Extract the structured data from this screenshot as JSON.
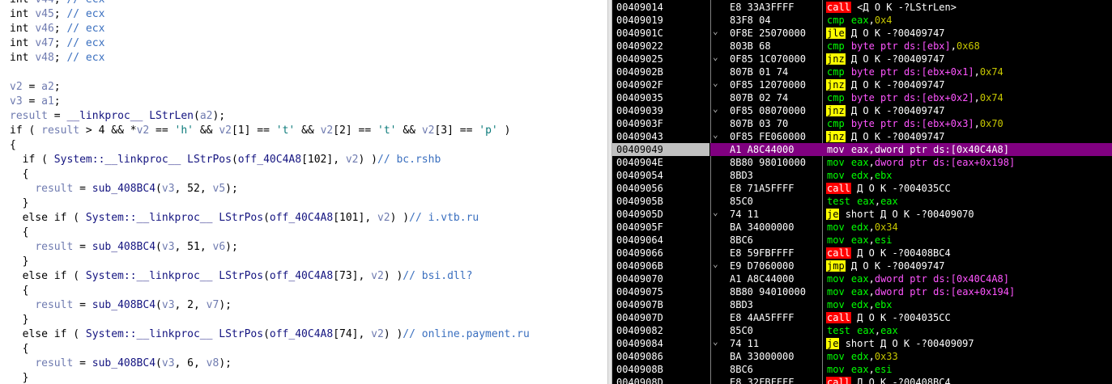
{
  "code": {
    "lines": [
      [
        [
          "kw",
          "int "
        ],
        [
          "var",
          "v44"
        ],
        [
          "kw",
          "; "
        ],
        [
          "cmt",
          "// ecx"
        ]
      ],
      [
        [
          "kw",
          "int "
        ],
        [
          "var",
          "v45"
        ],
        [
          "kw",
          "; "
        ],
        [
          "cmt",
          "// ecx"
        ]
      ],
      [
        [
          "kw",
          "int "
        ],
        [
          "var",
          "v46"
        ],
        [
          "kw",
          "; "
        ],
        [
          "cmt",
          "// ecx"
        ]
      ],
      [
        [
          "kw",
          "int "
        ],
        [
          "var",
          "v47"
        ],
        [
          "kw",
          "; "
        ],
        [
          "cmt",
          "// ecx"
        ]
      ],
      [
        [
          "kw",
          "int "
        ],
        [
          "var",
          "v48"
        ],
        [
          "kw",
          "; "
        ],
        [
          "cmt",
          "// ecx"
        ]
      ],
      [],
      [
        [
          "var",
          "v2"
        ],
        [
          "kw",
          " = "
        ],
        [
          "var",
          "a2"
        ],
        [
          "kw",
          ";"
        ]
      ],
      [
        [
          "var",
          "v3"
        ],
        [
          "kw",
          " = "
        ],
        [
          "var",
          "a1"
        ],
        [
          "kw",
          ";"
        ]
      ],
      [
        [
          "var",
          "result"
        ],
        [
          "kw",
          " = "
        ],
        [
          "fn",
          "__linkproc__ LStrLen"
        ],
        [
          "kw",
          "("
        ],
        [
          "var",
          "a2"
        ],
        [
          "kw",
          ");"
        ]
      ],
      [
        [
          "kw",
          "if ( "
        ],
        [
          "var",
          "result"
        ],
        [
          "kw",
          " > 4 && *"
        ],
        [
          "var",
          "v2"
        ],
        [
          "kw",
          " == "
        ],
        [
          "str",
          "'h'"
        ],
        [
          "kw",
          " && "
        ],
        [
          "var",
          "v2"
        ],
        [
          "kw",
          "[1] == "
        ],
        [
          "str",
          "'t'"
        ],
        [
          "kw",
          " && "
        ],
        [
          "var",
          "v2"
        ],
        [
          "kw",
          "[2] == "
        ],
        [
          "str",
          "'t'"
        ],
        [
          "kw",
          " && "
        ],
        [
          "var",
          "v2"
        ],
        [
          "kw",
          "[3] == "
        ],
        [
          "str",
          "'p'"
        ],
        [
          "kw",
          " )"
        ]
      ],
      [
        [
          "kw",
          "{"
        ]
      ],
      [
        [
          "kw",
          "  if ( "
        ],
        [
          "fn",
          "System::__linkproc__ LStrPos"
        ],
        [
          "kw",
          "("
        ],
        [
          "fn",
          "off_40C4A8"
        ],
        [
          "kw",
          "[102], "
        ],
        [
          "var",
          "v2"
        ],
        [
          "kw",
          ") )"
        ],
        [
          "cmt",
          "// bc.rshb"
        ]
      ],
      [
        [
          "kw",
          "  {"
        ]
      ],
      [
        [
          "kw",
          "    "
        ],
        [
          "var",
          "result"
        ],
        [
          "kw",
          " = "
        ],
        [
          "fn",
          "sub_408BC4"
        ],
        [
          "kw",
          "("
        ],
        [
          "var",
          "v3"
        ],
        [
          "kw",
          ", 52, "
        ],
        [
          "var",
          "v5"
        ],
        [
          "kw",
          ");"
        ]
      ],
      [
        [
          "kw",
          "  }"
        ]
      ],
      [
        [
          "kw",
          "  else if ( "
        ],
        [
          "fn",
          "System::__linkproc__ LStrPos"
        ],
        [
          "kw",
          "("
        ],
        [
          "fn",
          "off_40C4A8"
        ],
        [
          "kw",
          "[101], "
        ],
        [
          "var",
          "v2"
        ],
        [
          "kw",
          ") )"
        ],
        [
          "cmt",
          "// i.vtb.ru"
        ]
      ],
      [
        [
          "kw",
          "  {"
        ]
      ],
      [
        [
          "kw",
          "    "
        ],
        [
          "var",
          "result"
        ],
        [
          "kw",
          " = "
        ],
        [
          "fn",
          "sub_408BC4"
        ],
        [
          "kw",
          "("
        ],
        [
          "var",
          "v3"
        ],
        [
          "kw",
          ", 51, "
        ],
        [
          "var",
          "v6"
        ],
        [
          "kw",
          ");"
        ]
      ],
      [
        [
          "kw",
          "  }"
        ]
      ],
      [
        [
          "kw",
          "  else if ( "
        ],
        [
          "fn",
          "System::__linkproc__ LStrPos"
        ],
        [
          "kw",
          "("
        ],
        [
          "fn",
          "off_40C4A8"
        ],
        [
          "kw",
          "[73], "
        ],
        [
          "var",
          "v2"
        ],
        [
          "kw",
          ") )"
        ],
        [
          "cmt",
          "// bsi.dll?"
        ]
      ],
      [
        [
          "kw",
          "  {"
        ]
      ],
      [
        [
          "kw",
          "    "
        ],
        [
          "var",
          "result"
        ],
        [
          "kw",
          " = "
        ],
        [
          "fn",
          "sub_408BC4"
        ],
        [
          "kw",
          "("
        ],
        [
          "var",
          "v3"
        ],
        [
          "kw",
          ", 2, "
        ],
        [
          "var",
          "v7"
        ],
        [
          "kw",
          ");"
        ]
      ],
      [
        [
          "kw",
          "  }"
        ]
      ],
      [
        [
          "kw",
          "  else if ( "
        ],
        [
          "fn",
          "System::__linkproc__ LStrPos"
        ],
        [
          "kw",
          "("
        ],
        [
          "fn",
          "off_40C4A8"
        ],
        [
          "kw",
          "[74], "
        ],
        [
          "var",
          "v2"
        ],
        [
          "kw",
          ") )"
        ],
        [
          "cmt",
          "// online.payment.ru"
        ]
      ],
      [
        [
          "kw",
          "  {"
        ]
      ],
      [
        [
          "kw",
          "    "
        ],
        [
          "var",
          "result"
        ],
        [
          "kw",
          " = "
        ],
        [
          "fn",
          "sub_408BC4"
        ],
        [
          "kw",
          "("
        ],
        [
          "var",
          "v3"
        ],
        [
          "kw",
          ", 6, "
        ],
        [
          "var",
          "v8"
        ],
        [
          "kw",
          ");"
        ]
      ],
      [
        [
          "kw",
          "  }"
        ]
      ]
    ]
  },
  "disasm": {
    "selected_index": 11,
    "rows": [
      {
        "addr": "00409014",
        "arrow": "",
        "bytes": "E8 33A3FFFF",
        "mn": "call",
        "cls": "call",
        "ops": [
          [
            "lbl",
            "<Д О К -?LStrLen>"
          ]
        ]
      },
      {
        "addr": "00409019",
        "arrow": "",
        "bytes": "83F8 04",
        "mn": "cmp",
        "cls": "cmp",
        "ops": [
          [
            "reg",
            "eax"
          ],
          [
            "comma",
            ","
          ],
          [
            "imm",
            "0x4"
          ]
        ]
      },
      {
        "addr": "0040901C",
        "arrow": "⌄",
        "bytes": "0F8E 25070000",
        "mn": "jle",
        "cls": "jcc",
        "ops": [
          [
            "lbl",
            "Д О К -?00409747"
          ]
        ]
      },
      {
        "addr": "00409022",
        "arrow": "",
        "bytes": "803B 68",
        "mn": "cmp",
        "cls": "cmp",
        "ops": [
          [
            "mem",
            "byte ptr ds:[ebx]"
          ],
          [
            "comma",
            ","
          ],
          [
            "imm",
            "0x68"
          ]
        ]
      },
      {
        "addr": "00409025",
        "arrow": "⌄",
        "bytes": "0F85 1C070000",
        "mn": "jnz",
        "cls": "jcc",
        "ops": [
          [
            "lbl",
            "Д О К -?00409747"
          ]
        ]
      },
      {
        "addr": "0040902B",
        "arrow": "",
        "bytes": "807B 01 74",
        "mn": "cmp",
        "cls": "cmp",
        "ops": [
          [
            "mem",
            "byte ptr ds:[ebx+0x1]"
          ],
          [
            "comma",
            ","
          ],
          [
            "imm",
            "0x74"
          ]
        ]
      },
      {
        "addr": "0040902F",
        "arrow": "⌄",
        "bytes": "0F85 12070000",
        "mn": "jnz",
        "cls": "jcc",
        "ops": [
          [
            "lbl",
            "Д О К -?00409747"
          ]
        ]
      },
      {
        "addr": "00409035",
        "arrow": "",
        "bytes": "807B 02 74",
        "mn": "cmp",
        "cls": "cmp",
        "ops": [
          [
            "mem",
            "byte ptr ds:[ebx+0x2]"
          ],
          [
            "comma",
            ","
          ],
          [
            "imm",
            "0x74"
          ]
        ]
      },
      {
        "addr": "00409039",
        "arrow": "⌄",
        "bytes": "0F85 08070000",
        "mn": "jnz",
        "cls": "jcc",
        "ops": [
          [
            "lbl",
            "Д О К -?00409747"
          ]
        ]
      },
      {
        "addr": "0040903F",
        "arrow": "",
        "bytes": "807B 03 70",
        "mn": "cmp",
        "cls": "cmp",
        "ops": [
          [
            "mem",
            "byte ptr ds:[ebx+0x3]"
          ],
          [
            "comma",
            ","
          ],
          [
            "imm",
            "0x70"
          ]
        ]
      },
      {
        "addr": "00409043",
        "arrow": "⌄",
        "bytes": "0F85 FE060000",
        "mn": "jnz",
        "cls": "jcc",
        "ops": [
          [
            "lbl",
            "Д О К -?00409747"
          ]
        ]
      },
      {
        "addr": "00409049",
        "arrow": "",
        "bytes": "A1 A8C44000",
        "mn": "mov",
        "cls": "mov",
        "ops": [
          [
            "reg",
            "eax"
          ],
          [
            "comma",
            ","
          ],
          [
            "mem",
            "dword ptr ds:[0x40C4A8]"
          ]
        ]
      },
      {
        "addr": "0040904E",
        "arrow": "",
        "bytes": "8B80 98010000",
        "mn": "mov",
        "cls": "mov",
        "ops": [
          [
            "reg",
            "eax"
          ],
          [
            "comma",
            ","
          ],
          [
            "mem",
            "dword ptr ds:[eax+0x198]"
          ]
        ]
      },
      {
        "addr": "00409054",
        "arrow": "",
        "bytes": "8BD3",
        "mn": "mov",
        "cls": "mov",
        "ops": [
          [
            "reg",
            "edx"
          ],
          [
            "comma",
            ","
          ],
          [
            "reg",
            "ebx"
          ]
        ]
      },
      {
        "addr": "00409056",
        "arrow": "",
        "bytes": "E8 71A5FFFF",
        "mn": "call",
        "cls": "call",
        "ops": [
          [
            "lbl",
            "Д О К -?004035CC"
          ]
        ]
      },
      {
        "addr": "0040905B",
        "arrow": "",
        "bytes": "85C0",
        "mn": "test",
        "cls": "test",
        "ops": [
          [
            "reg",
            "eax"
          ],
          [
            "comma",
            ","
          ],
          [
            "reg",
            "eax"
          ]
        ]
      },
      {
        "addr": "0040905D",
        "arrow": "⌄",
        "bytes": "74 11",
        "mn": "je",
        "cls": "jcc",
        "ops": [
          [
            "lbl",
            "short Д О К -?00409070"
          ]
        ]
      },
      {
        "addr": "0040905F",
        "arrow": "",
        "bytes": "BA 34000000",
        "mn": "mov",
        "cls": "mov",
        "ops": [
          [
            "reg",
            "edx"
          ],
          [
            "comma",
            ","
          ],
          [
            "imm",
            "0x34"
          ]
        ]
      },
      {
        "addr": "00409064",
        "arrow": "",
        "bytes": "8BC6",
        "mn": "mov",
        "cls": "mov",
        "ops": [
          [
            "reg",
            "eax"
          ],
          [
            "comma",
            ","
          ],
          [
            "reg",
            "esi"
          ]
        ]
      },
      {
        "addr": "00409066",
        "arrow": "",
        "bytes": "E8 59FBFFFF",
        "mn": "call",
        "cls": "call",
        "ops": [
          [
            "lbl",
            "Д О К -?00408BC4"
          ]
        ]
      },
      {
        "addr": "0040906B",
        "arrow": "⌄",
        "bytes": "E9 D7060000",
        "mn": "jmp",
        "cls": "jcc",
        "ops": [
          [
            "lbl",
            "Д О К -?00409747"
          ]
        ]
      },
      {
        "addr": "00409070",
        "arrow": "",
        "bytes": "A1 A8C44000",
        "mn": "mov",
        "cls": "mov",
        "ops": [
          [
            "reg",
            "eax"
          ],
          [
            "comma",
            ","
          ],
          [
            "mem",
            "dword ptr ds:[0x40C4A8]"
          ]
        ]
      },
      {
        "addr": "00409075",
        "arrow": "",
        "bytes": "8B80 94010000",
        "mn": "mov",
        "cls": "mov",
        "ops": [
          [
            "reg",
            "eax"
          ],
          [
            "comma",
            ","
          ],
          [
            "mem",
            "dword ptr ds:[eax+0x194]"
          ]
        ]
      },
      {
        "addr": "0040907B",
        "arrow": "",
        "bytes": "8BD3",
        "mn": "mov",
        "cls": "mov",
        "ops": [
          [
            "reg",
            "edx"
          ],
          [
            "comma",
            ","
          ],
          [
            "reg",
            "ebx"
          ]
        ]
      },
      {
        "addr": "0040907D",
        "arrow": "",
        "bytes": "E8 4AA5FFFF",
        "mn": "call",
        "cls": "call",
        "ops": [
          [
            "lbl",
            "Д О К -?004035CC"
          ]
        ]
      },
      {
        "addr": "00409082",
        "arrow": "",
        "bytes": "85C0",
        "mn": "test",
        "cls": "test",
        "ops": [
          [
            "reg",
            "eax"
          ],
          [
            "comma",
            ","
          ],
          [
            "reg",
            "eax"
          ]
        ]
      },
      {
        "addr": "00409084",
        "arrow": "⌄",
        "bytes": "74 11",
        "mn": "je",
        "cls": "jcc",
        "ops": [
          [
            "lbl",
            "short Д О К -?00409097"
          ]
        ]
      },
      {
        "addr": "00409086",
        "arrow": "",
        "bytes": "BA 33000000",
        "mn": "mov",
        "cls": "mov",
        "ops": [
          [
            "reg",
            "edx"
          ],
          [
            "comma",
            ","
          ],
          [
            "imm",
            "0x33"
          ]
        ]
      },
      {
        "addr": "0040908B",
        "arrow": "",
        "bytes": "8BC6",
        "mn": "mov",
        "cls": "mov",
        "ops": [
          [
            "reg",
            "eax"
          ],
          [
            "comma",
            ","
          ],
          [
            "reg",
            "esi"
          ]
        ]
      },
      {
        "addr": "0040908D",
        "arrow": "",
        "bytes": "E8 32FBFFFF",
        "mn": "call",
        "cls": "call",
        "ops": [
          [
            "lbl",
            "Д О К -?00408BC4"
          ]
        ]
      }
    ]
  }
}
